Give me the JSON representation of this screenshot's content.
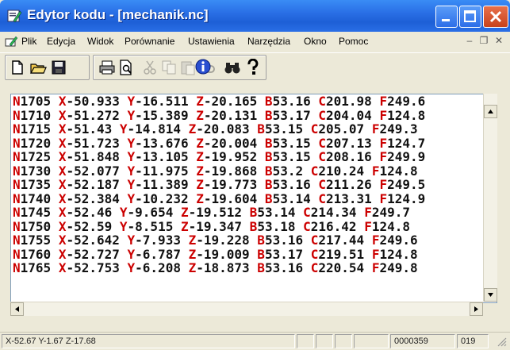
{
  "window": {
    "title": "Edytor kodu - [mechanik.nc]",
    "buttons": {
      "minimize": "minimize",
      "maximize": "maximize",
      "close": "close"
    }
  },
  "menu": {
    "items": [
      "Plik",
      "Edycja",
      "Widok",
      "Porównanie",
      "Ustawienia",
      "Narzędzia",
      "Okno",
      "Pomoc"
    ]
  },
  "toolbar": {
    "icons": [
      "new-file-icon",
      "open-folder-icon",
      "save-icon",
      "print-icon",
      "print-preview-icon",
      "cut-icon",
      "copy-icon",
      "paste-icon",
      "undo-icon",
      "find-icon",
      "help-icon",
      "info-icon"
    ]
  },
  "editor": {
    "lines": [
      [
        "N1705",
        "X-50.933",
        "Y-16.511",
        "Z-20.165",
        "B53.16",
        "C201.98",
        "F249.6"
      ],
      [
        "N1710",
        "X-51.272",
        "Y-15.389",
        "Z-20.131",
        "B53.17",
        "C204.04",
        "F124.8"
      ],
      [
        "N1715",
        "X-51.43",
        "Y-14.814",
        "Z-20.083",
        "B53.15",
        "C205.07",
        "F249.3"
      ],
      [
        "N1720",
        "X-51.723",
        "Y-13.676",
        "Z-20.004",
        "B53.15",
        "C207.13",
        "F124.7"
      ],
      [
        "N1725",
        "X-51.848",
        "Y-13.105",
        "Z-19.952",
        "B53.15",
        "C208.16",
        "F249.9"
      ],
      [
        "N1730",
        "X-52.077",
        "Y-11.975",
        "Z-19.868",
        "B53.2",
        "C210.24",
        "F124.8"
      ],
      [
        "N1735",
        "X-52.187",
        "Y-11.389",
        "Z-19.773",
        "B53.16",
        "C211.26",
        "F249.5"
      ],
      [
        "N1740",
        "X-52.384",
        "Y-10.232",
        "Z-19.604",
        "B53.14",
        "C213.31",
        "F124.9"
      ],
      [
        "N1745",
        "X-52.46",
        "Y-9.654",
        "Z-19.512",
        "B53.14",
        "C214.34",
        "F249.7"
      ],
      [
        "N1750",
        "X-52.59",
        "Y-8.515",
        "Z-19.347",
        "B53.18",
        "C216.42",
        "F124.8"
      ],
      [
        "N1755",
        "X-52.642",
        "Y-7.933",
        "Z-19.228",
        "B53.16",
        "C217.44",
        "F249.6"
      ],
      [
        "N1760",
        "X-52.727",
        "Y-6.787",
        "Z-19.009",
        "B53.17",
        "C219.51",
        "F124.8"
      ],
      [
        "N1765",
        "X-52.753",
        "Y-6.208",
        "Z-18.873",
        "B53.16",
        "C220.54",
        "F249.8"
      ]
    ]
  },
  "status": {
    "position": "X-52.67 Y-1.67 Z-17.68",
    "line_number": "0000359",
    "column": "019"
  },
  "colors": {
    "title_bar": "#2a6fe6",
    "address_letter": "#cc0000",
    "code_text": "#111111"
  }
}
